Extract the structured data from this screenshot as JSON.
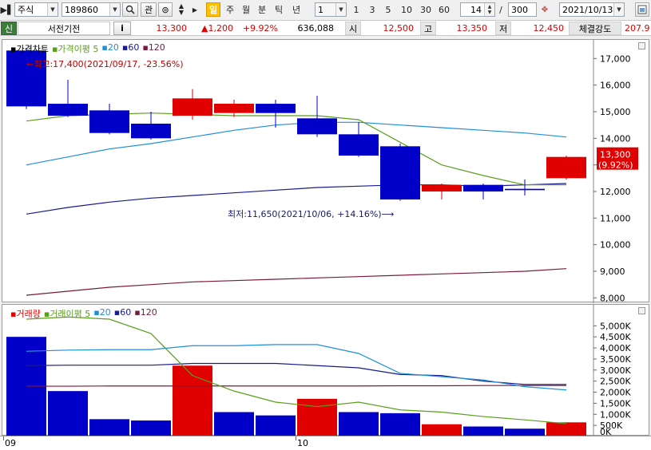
{
  "toolbar": {
    "market_type": "주식",
    "stock_code": "189860",
    "search_icon": "search-icon",
    "btn_gwan": "관",
    "periods": [
      "일",
      "주",
      "월",
      "분",
      "틱",
      "년"
    ],
    "active_period": "일",
    "interval_value": "1",
    "intervals": [
      "1",
      "3",
      "5",
      "10",
      "30",
      "60"
    ],
    "view_count": "14",
    "slash": "/",
    "total_count": "300",
    "date": "2021/10/13"
  },
  "quote": {
    "credit_badge": "신",
    "stock_name": "서전기전",
    "info_button": "i",
    "price": "13,300",
    "change": "▲1,200",
    "change_pct": "+9.92%",
    "volume": "636,088",
    "open_label": "시",
    "open": "12,500",
    "high_label": "고",
    "high": "13,350",
    "low_label": "저",
    "low": "12,450",
    "strength_label": "체결강도",
    "strength": "207.9"
  },
  "colors": {
    "up": "#e00000",
    "down": "#0000c8",
    "ma5": "#5a9e1c",
    "ma20": "#1f8fd6",
    "ma60": "#1a1a8c",
    "ma120": "#7a1a3a"
  },
  "chart_data": [
    {
      "type": "candlestick",
      "legend": [
        "가격차트",
        "가격이평",
        "5",
        "20",
        "60",
        "120"
      ],
      "y_ticks": [
        "17,000",
        "16,000",
        "15,000",
        "14,000",
        "13,000",
        "12,000",
        "11,000",
        "10,000",
        "9,000",
        "8,000"
      ],
      "ylim": [
        7800,
        17700
      ],
      "x_labels": [
        "09",
        "10"
      ],
      "candles": [
        {
          "o": 17300,
          "h": 17400,
          "l": 15100,
          "c": 15200
        },
        {
          "o": 15300,
          "h": 16200,
          "l": 14800,
          "c": 14850
        },
        {
          "o": 15050,
          "h": 15300,
          "l": 14150,
          "c": 14200
        },
        {
          "o": 14550,
          "h": 15000,
          "l": 13950,
          "c": 14000
        },
        {
          "o": 14850,
          "h": 15850,
          "l": 14700,
          "c": 15500
        },
        {
          "o": 14950,
          "h": 15450,
          "l": 14800,
          "c": 15300
        },
        {
          "o": 15300,
          "h": 15450,
          "l": 14400,
          "c": 14950
        },
        {
          "o": 14750,
          "h": 15600,
          "l": 14050,
          "c": 14150
        },
        {
          "o": 14150,
          "h": 14600,
          "l": 13300,
          "c": 13350
        },
        {
          "o": 13700,
          "h": 13800,
          "l": 11650,
          "c": 11700
        },
        {
          "o": 12000,
          "h": 12300,
          "l": 11700,
          "c": 12250
        },
        {
          "o": 12250,
          "h": 12300,
          "l": 11700,
          "c": 12000
        },
        {
          "o": 12100,
          "h": 12450,
          "l": 11850,
          "c": 12050
        },
        {
          "o": 12500,
          "h": 13350,
          "l": 12450,
          "c": 13300
        }
      ],
      "ma5": [
        14650,
        14850,
        14900,
        14950,
        14900,
        14850,
        14850,
        14850,
        14700,
        13850,
        13000,
        12600,
        12250,
        12250
      ],
      "ma20": [
        13000,
        13300,
        13600,
        13800,
        14050,
        14300,
        14500,
        14600,
        14600,
        14500,
        14400,
        14300,
        14200,
        14050
      ],
      "ma60": [
        11150,
        11400,
        11600,
        11750,
        11850,
        11950,
        12050,
        12150,
        12200,
        12250,
        12250,
        12200,
        12250,
        12300
      ],
      "ma120": [
        8100,
        8250,
        8400,
        8500,
        8600,
        8650,
        8700,
        8750,
        8800,
        8850,
        8900,
        8950,
        9000,
        9100
      ],
      "annotation_high": "←최고:17,400(2021/09/17, -23.56%)",
      "annotation_low": "최저:11,650(2021/10/06, +14.16%)⟶",
      "current_price_label": "13,300",
      "current_pct_label": "(9.92%)"
    },
    {
      "type": "bar",
      "legend": [
        "거래량",
        "거래이평",
        "5",
        "20",
        "60",
        "120"
      ],
      "y_ticks": [
        "5,000K",
        "4,500K",
        "4,000K",
        "3,500K",
        "3,000K",
        "2,500K",
        "2,000K",
        "1,500K",
        "1,000K",
        "500K",
        "0K"
      ],
      "ylim": [
        0,
        5300
      ],
      "values": [
        4500,
        2050,
        780,
        720,
        3200,
        1100,
        950,
        1700,
        1100,
        1050,
        550,
        450,
        350,
        636
      ],
      "up": [
        false,
        false,
        false,
        false,
        true,
        false,
        false,
        true,
        false,
        false,
        true,
        false,
        false,
        true
      ],
      "ma5": [
        5300,
        5400,
        5300,
        4650,
        2750,
        2050,
        1550,
        1350,
        1550,
        1200,
        1100,
        900,
        750,
        580
      ],
      "ma20": [
        3850,
        3900,
        3920,
        3920,
        4100,
        4100,
        4150,
        4150,
        3750,
        2850,
        2700,
        2550,
        2250,
        2100
      ],
      "ma60": [
        3200,
        3220,
        3220,
        3220,
        3300,
        3300,
        3300,
        3200,
        3100,
        2800,
        2750,
        2500,
        2350,
        2350
      ],
      "ma120": [
        2270,
        2270,
        2280,
        2280,
        2280,
        2280,
        2280,
        2280,
        2280,
        2290,
        2290,
        2300,
        2300,
        2300
      ]
    }
  ]
}
